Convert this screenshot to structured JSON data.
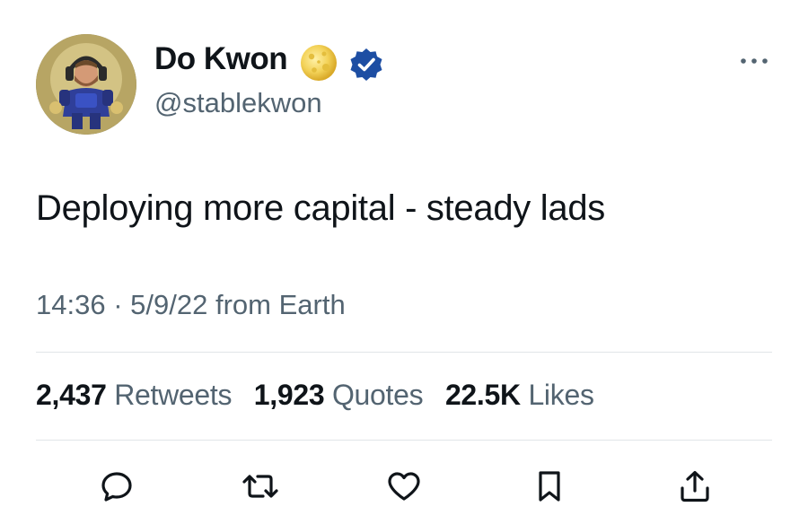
{
  "author": {
    "display_name": "Do Kwon",
    "handle": "@stablekwon",
    "badges": [
      "moon-emoji",
      "verified-badge"
    ],
    "verified_color": "#1d4ea3"
  },
  "tweet": {
    "text": "Deploying more capital - steady lads",
    "time": "14:36",
    "separator": "·",
    "date": "5/9/22",
    "source": "from Earth"
  },
  "stats": {
    "retweets": {
      "count": "2,437",
      "label": "Retweets"
    },
    "quotes": {
      "count": "1,923",
      "label": "Quotes"
    },
    "likes": {
      "count": "22.5K",
      "label": "Likes"
    }
  },
  "actions": [
    "reply-icon",
    "retweet-icon",
    "like-icon",
    "bookmark-icon",
    "share-icon"
  ],
  "colors": {
    "text_primary": "#0f1419",
    "text_secondary": "#536471",
    "divider": "#e1e5e8"
  }
}
